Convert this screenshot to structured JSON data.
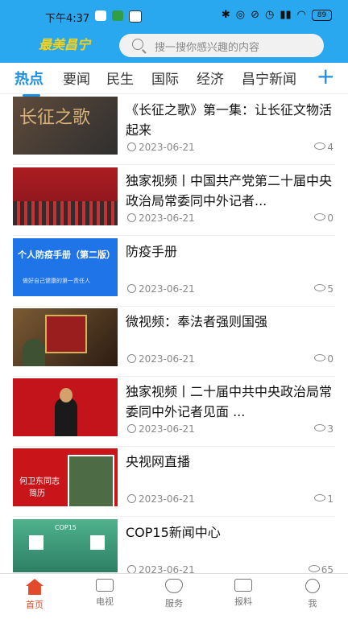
{
  "status": {
    "time": "下午4:37",
    "battery": "89"
  },
  "header": {
    "logo": "最美昌宁",
    "search_placeholder": "搜一搜你感兴趣的内容"
  },
  "tabs": [
    "热点",
    "要闻",
    "民生",
    "国际",
    "经济",
    "昌宁新闻"
  ],
  "articles": [
    {
      "title": "《长征之歌》第一集：让长征文物活起来",
      "date": "2023-06-21",
      "views": "4"
    },
    {
      "title": "独家视频丨中国共产党第二十届中央政治局常委同中外记者...",
      "date": "2023-06-21",
      "views": "0"
    },
    {
      "title": "防疫手册",
      "date": "2023-06-21",
      "views": "5"
    },
    {
      "title": "微视频：奉法者强则国强",
      "date": "2023-06-21",
      "views": "0"
    },
    {
      "title": "独家视频丨二十届中共中央政治局常委同中外记者见面 ...",
      "date": "2023-06-21",
      "views": "3"
    },
    {
      "title": "央视网直播",
      "date": "2023-06-21",
      "views": "1"
    },
    {
      "title": "COP15新闻中心",
      "date": "2023-06-21",
      "views": "65"
    }
  ],
  "thumb_text": {
    "t1": "长征之歌",
    "t3_title": "个人防疫手册（第二版）",
    "t3_sub": "做好自己健康的第一责任人",
    "t6_name": "何卫东同志",
    "t6_sub": "简历",
    "t7": "COP15"
  },
  "nav": [
    {
      "label": "首页",
      "active": true
    },
    {
      "label": "电视"
    },
    {
      "label": "服务"
    },
    {
      "label": "报料"
    },
    {
      "label": "我"
    }
  ],
  "colors": {
    "brand": "#2aa8ef",
    "accent": "#1e8fde",
    "home_active": "#e24a2a"
  }
}
